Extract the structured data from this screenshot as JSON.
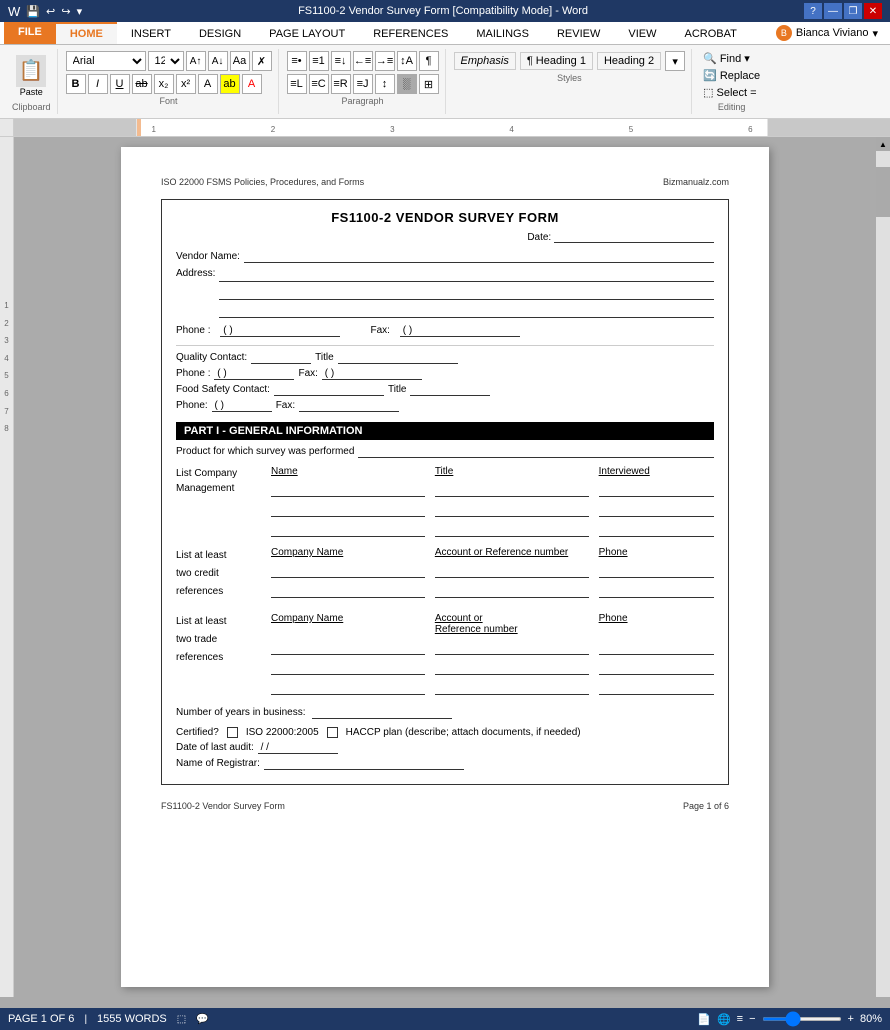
{
  "titlebar": {
    "title": "FS1100-2 Vendor Survey Form [Compatibility Mode] - Word",
    "help_icon": "?",
    "minimize": "—",
    "restore": "❐",
    "close": "✕"
  },
  "ribbon": {
    "tabs": [
      "FILE",
      "HOME",
      "INSERT",
      "DESIGN",
      "PAGE LAYOUT",
      "REFERENCES",
      "MAILINGS",
      "REVIEW",
      "VIEW",
      "ACROBAT"
    ],
    "active_tab": "HOME",
    "user": "Bianca Viviano",
    "font": "Arial",
    "font_size": "12",
    "font_buttons": [
      "B",
      "I",
      "U"
    ],
    "groups": {
      "clipboard": {
        "label": "Clipboard",
        "paste": "Paste"
      },
      "font": {
        "label": "Font"
      },
      "paragraph": {
        "label": "Paragraph"
      },
      "styles": {
        "label": "Styles",
        "items": [
          "Emphasis",
          "¶ Heading 1",
          "Heading 2"
        ]
      },
      "editing": {
        "label": "Editing",
        "find": "Find",
        "replace": "Replace",
        "select": "Select ="
      }
    }
  },
  "page_header": {
    "left": "ISO 22000 FSMS Policies, Procedures, and Forms",
    "right": "Bizmanualz.com"
  },
  "form": {
    "title": "FS1100-2 VENDOR SURVEY FORM",
    "date_label": "Date:",
    "vendor_name_label": "Vendor Name:",
    "address_label": "Address:",
    "phone_label": "Phone :",
    "phone_placeholder": "(         )",
    "fax_label": "Fax:",
    "fax_placeholder": "(         )",
    "quality_contact_label": "Quality Contact:",
    "title_label": "Title",
    "phone2_label": "Phone :",
    "fax2_label": "Fax:",
    "food_safety_label": "Food Safety Contact:",
    "title2_label": "Title",
    "phone3_label": "Phone:",
    "fax3_label": "Fax:",
    "section1": {
      "title": "PART I - GENERAL INFORMATION",
      "product_label": "Product for which survey was performed",
      "list_company_label": "List Company\nManagement",
      "name_col": "Name",
      "title_col": "Title",
      "interviewed_col": "Interviewed",
      "credit_label": "List at least\ntwo credit\nreferences",
      "company_name_col": "Company Name",
      "account_col": "Account or\nReference number",
      "phone_col": "Phone",
      "trade_label": "List at least\ntwo trade\nreferences",
      "company_name_col2": "Company Name",
      "account_col2": "Account or\nReference number",
      "phone_col2": "Phone",
      "years_label": "Number of years in business:",
      "certified_label": "Certified?",
      "iso_label": "ISO 22000:2005",
      "haccp_label": "HACCP plan (describe; attach documents, if needed)",
      "last_audit_label": "Date of last audit:",
      "registrar_label": "Name of Registrar:",
      "date_format": "       /       /"
    }
  },
  "page_footer": {
    "left": "FS1100-2 Vendor Survey Form",
    "right": "Page 1 of 6"
  },
  "status_bar": {
    "page": "PAGE 1 OF 6",
    "words": "1555 WORDS",
    "zoom": "80%"
  }
}
